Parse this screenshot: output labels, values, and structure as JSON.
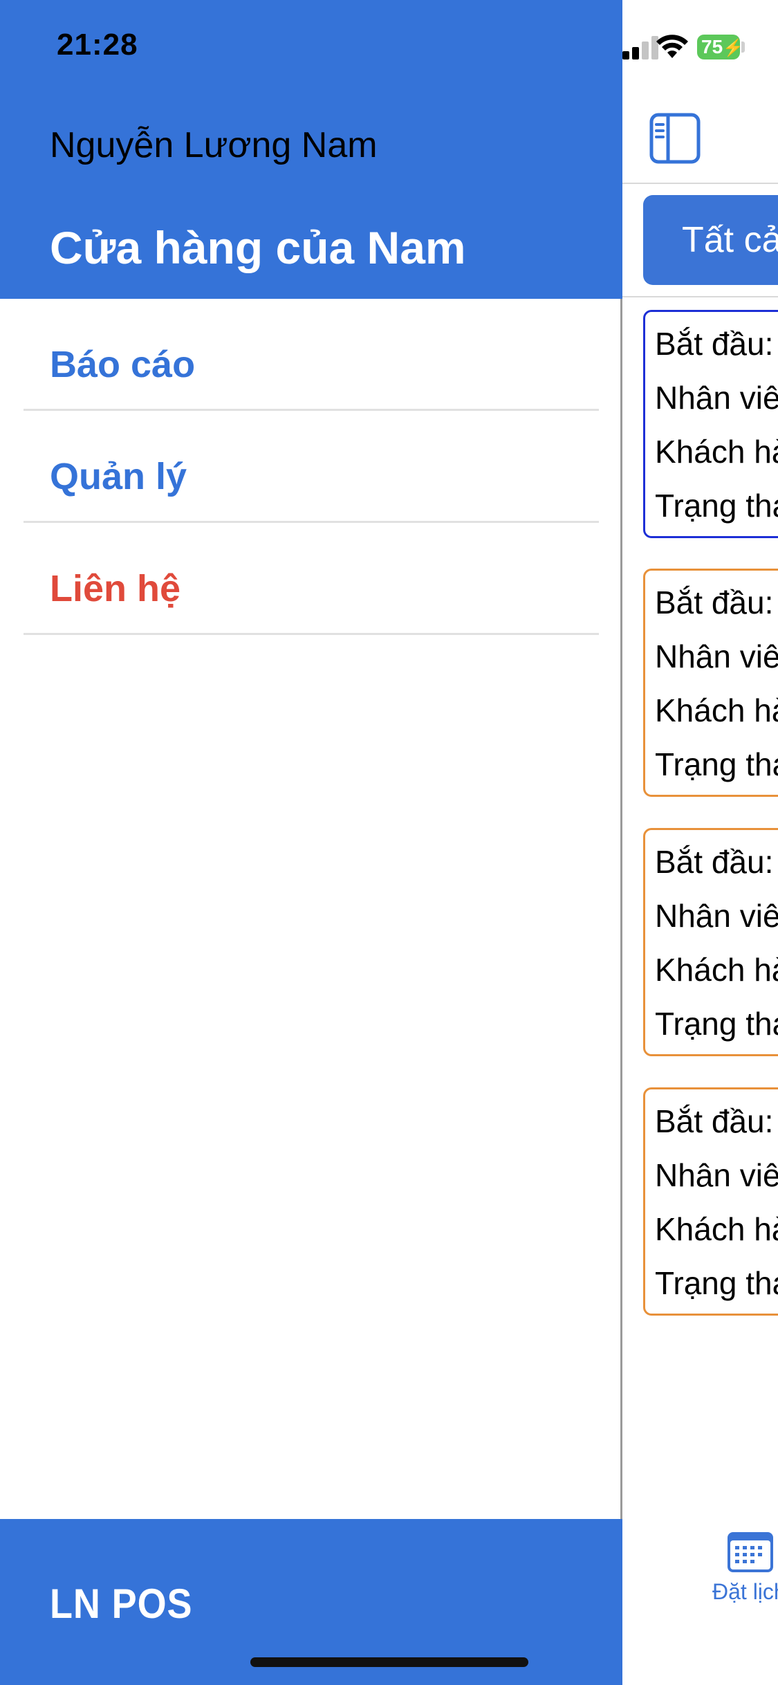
{
  "status_bar": {
    "time": "21:28",
    "battery_level": "75",
    "signal_bars_active": 2,
    "signal_bars_total": 4
  },
  "drawer": {
    "user_name": "Nguyễn Lương Nam",
    "store_name": "Cửa hàng của Nam",
    "menu_items": [
      {
        "label": "Báo cáo",
        "color": "#3573d8"
      },
      {
        "label": "Quản lý",
        "color": "#3573d8"
      },
      {
        "label": "Liên hệ",
        "color": "#e04a3b"
      }
    ],
    "footer_brand": "LN POS"
  },
  "main": {
    "filter_label": "Tất cả",
    "cards": [
      {
        "state": "selected",
        "lines": [
          "Bắt đầu:",
          "Nhân viên",
          "Khách hàng",
          "Trạng thái"
        ]
      },
      {
        "state": "pending",
        "lines": [
          "Bắt đầu:",
          "Nhân viên",
          "Khách hàng",
          "Trạng thái"
        ]
      },
      {
        "state": "pending",
        "lines": [
          "Bắt đầu:",
          "Nhân viên",
          "Khách hàng",
          "Trạng thái"
        ]
      },
      {
        "state": "pending",
        "lines": [
          "Bắt đầu:",
          "Nhân viên",
          "Khách hàng",
          "Trạng thái"
        ]
      }
    ],
    "tab_bar": {
      "calendar_label": "Đặt lịch"
    }
  },
  "colors": {
    "primary": "#3573d8",
    "accent_red": "#e04a3b",
    "card_selected_border": "#1d2fd6",
    "card_pending_border": "#e8913a",
    "battery_green": "#5cc85a"
  }
}
